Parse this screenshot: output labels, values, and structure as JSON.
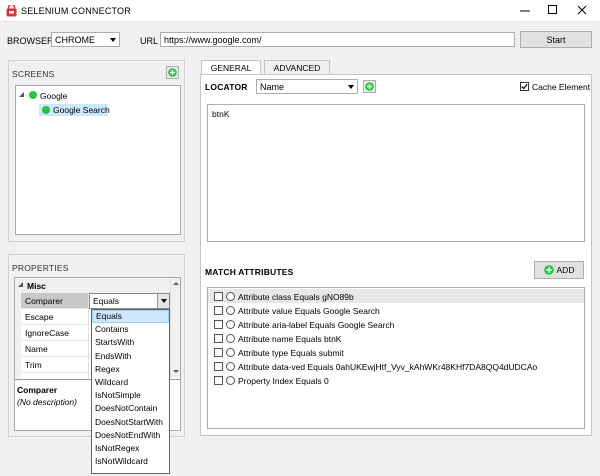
{
  "window": {
    "title": "SELENIUM CONNECTOR"
  },
  "toolbar": {
    "browser_label": "BROWSER",
    "browser_value": "CHROME",
    "url_label": "URL",
    "url_value": "https://www.google.com/",
    "start_label": "Start"
  },
  "screens": {
    "header": "SCREENS",
    "tree": [
      {
        "label": "Google",
        "level": 0
      },
      {
        "label": "Google Search",
        "level": 1,
        "selected": true
      }
    ]
  },
  "properties": {
    "header": "PROPERTIES",
    "category": "Misc",
    "rows": [
      "Comparer",
      "Escape",
      "IgnoreCase",
      "Name",
      "Trim"
    ],
    "comparer_value": "Equals",
    "description_title": "Comparer",
    "description_text": "(No description)",
    "dropdown_options": [
      "Equals",
      "Contains",
      "StartsWith",
      "EndsWith",
      "Regex",
      "Wildcard",
      "IsNotSimple",
      "DoesNotContain",
      "DoesNotStartWith",
      "DoesNotEndWith",
      "IsNotRegex",
      "IsNotWildcard"
    ]
  },
  "tabs": {
    "general": "GENERAL",
    "advanced": "ADVANCED"
  },
  "locator": {
    "label": "LOCATOR",
    "type_value": "Name",
    "cache_label": "Cache Element",
    "cache_checked": true,
    "value_text": "btnK"
  },
  "match_attributes": {
    "header": "MATCH ATTRIBUTES",
    "add_label": "ADD",
    "items": [
      "Attribute class Equals gNO89b",
      "Attribute value Equals Google Search",
      "Attribute aria-label Equals Google Search",
      "Attribute name Equals btnK",
      "Attribute type Equals submit",
      "Attribute data-ved Equals 0ahUKEwjHtf_Vyv_kAhWKr48KHf7DA8QQ4dUDCAo",
      "Property Index Equals 0"
    ]
  },
  "colors": {
    "accent_green": "#22c83c",
    "selection": "#cce8ff",
    "app_icon_red": "#e0303a"
  }
}
